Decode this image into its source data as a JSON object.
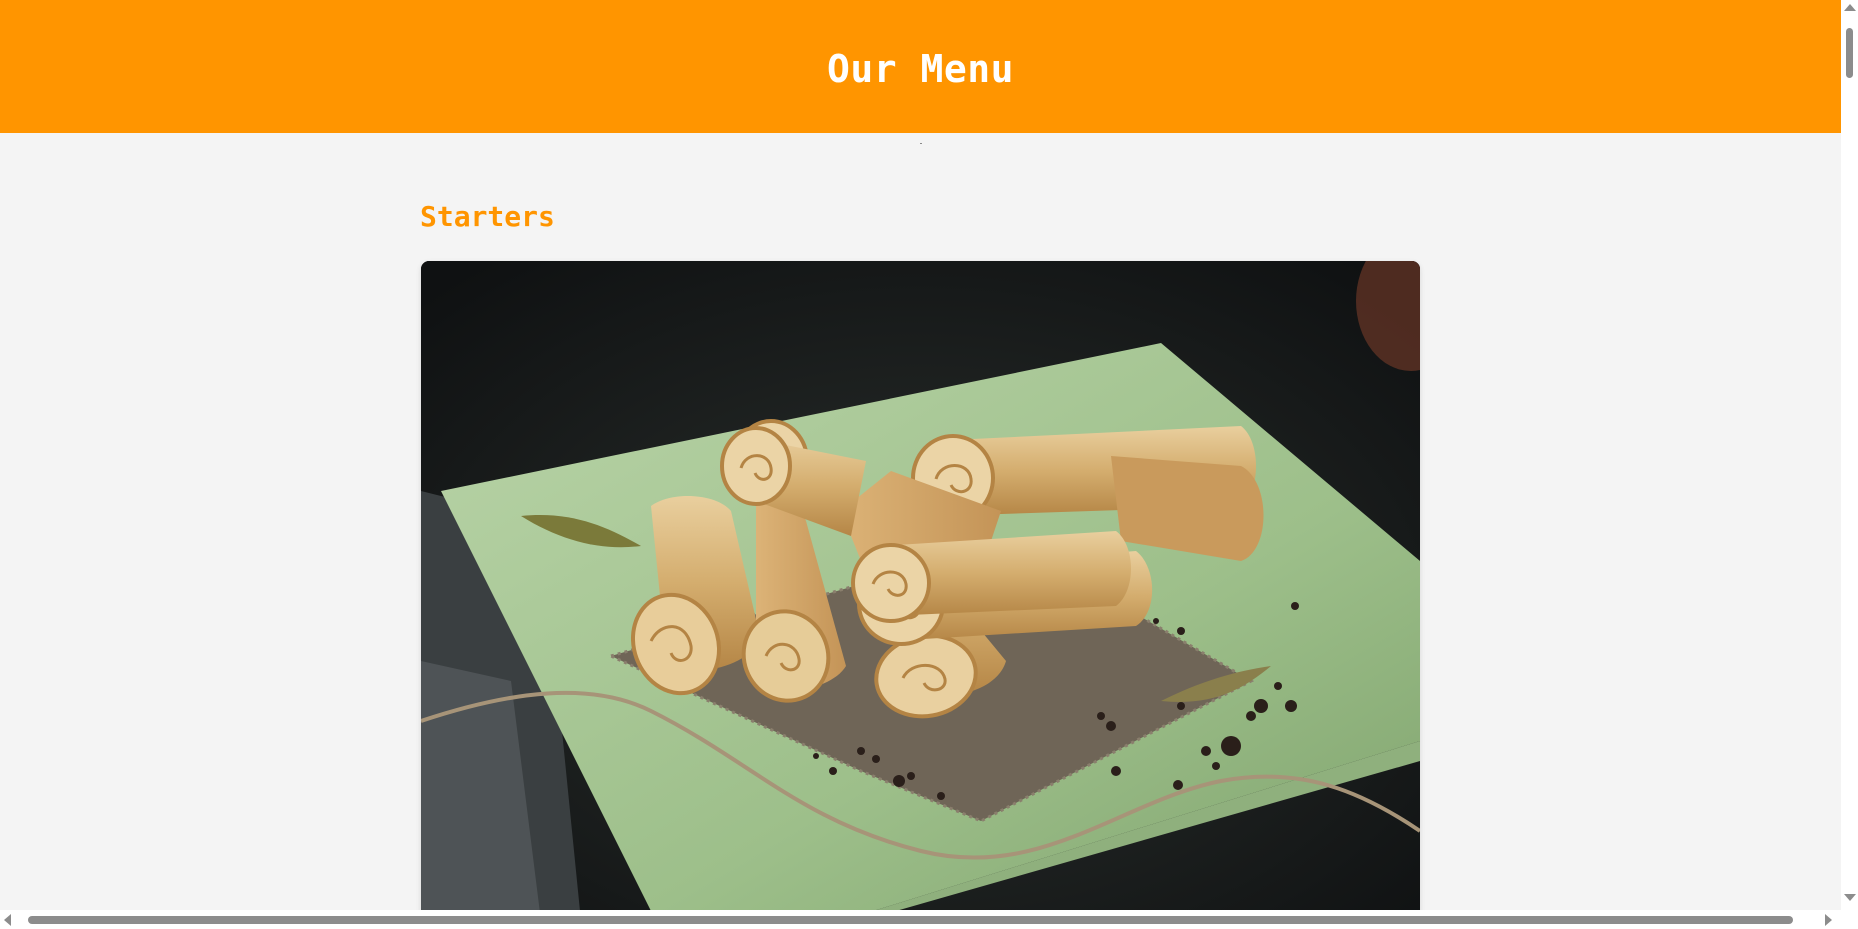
{
  "header": {
    "title": "Our Menu",
    "background_color": "#ff9500",
    "text_color": "#ffffff"
  },
  "sections": [
    {
      "title": "Starters",
      "title_color": "#ff9500"
    }
  ],
  "page": {
    "background_color": "#f4f4f4"
  }
}
